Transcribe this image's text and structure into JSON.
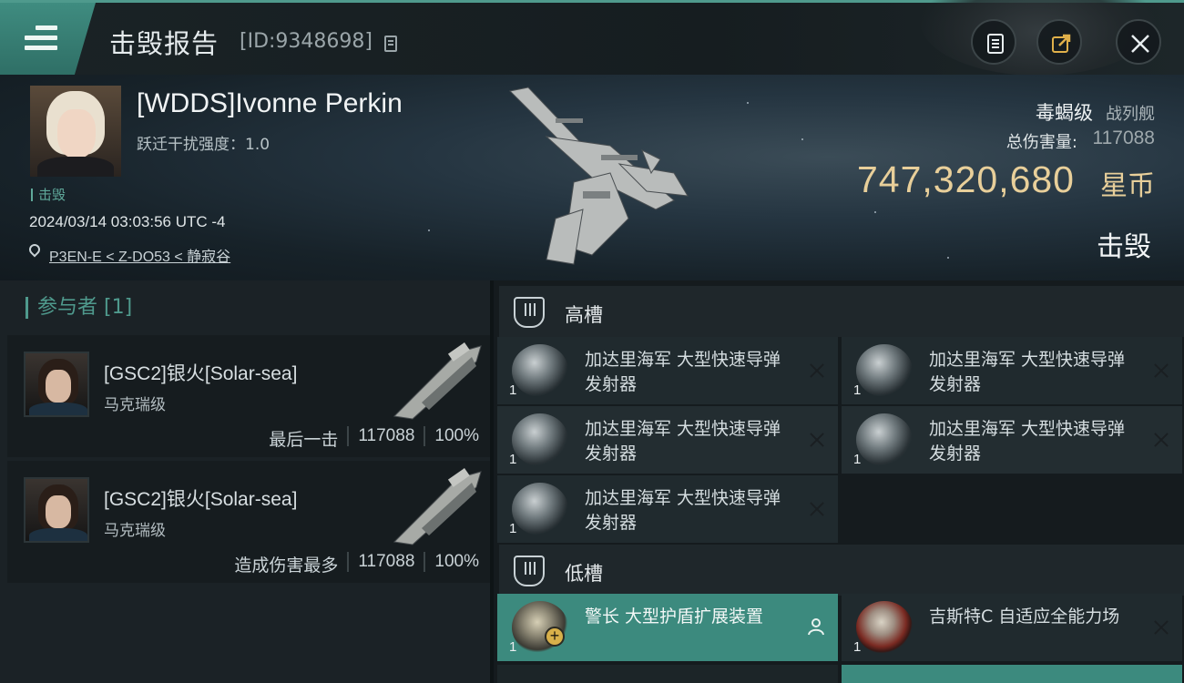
{
  "header": {
    "title": "击毁报告",
    "report_id": "[ID:9348698]"
  },
  "victim": {
    "name": "[WDDS]Ivonne Perkin",
    "warp_disruption": "跃迁干扰强度：1.0",
    "tag": "击毁",
    "time": "2024/03/14 03:03:56 UTC -4",
    "location": "P3EN-E < Z-DO53 < 静寂谷",
    "ship_class": "毒蝎级",
    "ship_type": "战列舰",
    "damage_label": "总伤害量:",
    "damage_value": "117088",
    "isk_value": "747,320,680",
    "isk_unit": "星币",
    "result": "击毁"
  },
  "participants": {
    "header": "参与者 [1]",
    "list": [
      {
        "name": "[GSC2]银火[Solar-sea]",
        "ship": "马克瑞级",
        "role": "最后一击",
        "damage": "117088",
        "percent": "100%"
      },
      {
        "name": "[GSC2]银火[Solar-sea]",
        "ship": "马克瑞级",
        "role": "造成伤害最多",
        "damage": "117088",
        "percent": "100%"
      }
    ]
  },
  "fitting": {
    "high_slot_label": "高槽",
    "low_slot_label": "低槽",
    "high_slots": [
      {
        "name": "加达里海军 大型快速导弹发射器",
        "qty": "1"
      },
      {
        "name": "加达里海军 大型快速导弹发射器",
        "qty": "1"
      },
      {
        "name": "加达里海军 大型快速导弹发射器",
        "qty": "1"
      },
      {
        "name": "加达里海军 大型快速导弹发射器",
        "qty": "1"
      },
      {
        "name": "加达里海军 大型快速导弹发射器",
        "qty": "1"
      }
    ],
    "low_slots": [
      {
        "name": "警长 大型护盾扩展装置",
        "qty": "1"
      },
      {
        "name": "吉斯特C 自适应全能力场",
        "qty": "1"
      }
    ]
  },
  "colors": {
    "accent": "#4f9a8d",
    "active_row": "#3c8a7e",
    "isk_gold": "#e8cf9a"
  }
}
